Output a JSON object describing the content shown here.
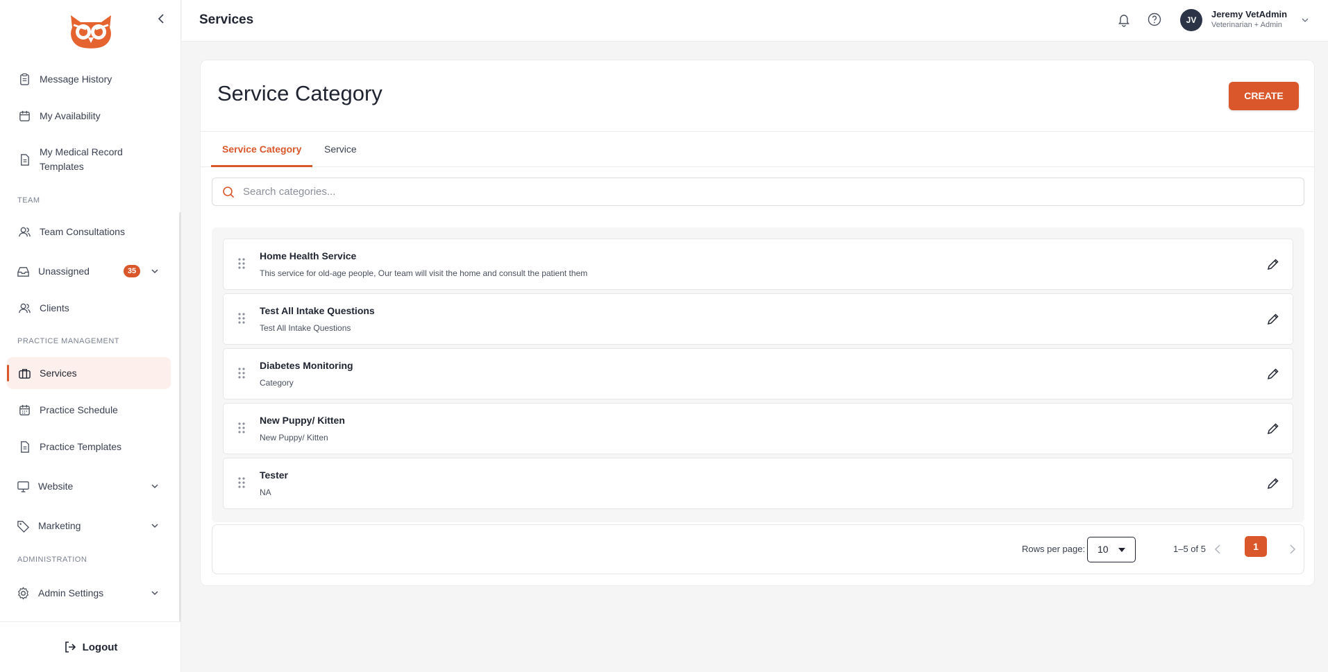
{
  "colors": {
    "accent": "#d9572a",
    "active_bg": "#fdf0ec",
    "avatar_bg": "#2b3346"
  },
  "sidebar": {
    "logo_icon": "owl-logo-icon",
    "items_top": [
      {
        "label": "Message History",
        "icon": "clipboard-icon"
      },
      {
        "label": "My Availability",
        "icon": "calendar-icon"
      },
      {
        "label": "My Medical Record Templates",
        "icon": "document-icon"
      }
    ],
    "section_team": "TEAM",
    "team_items": [
      {
        "label": "Team Consultations",
        "icon": "users-icon"
      },
      {
        "label": "Unassigned",
        "icon": "inbox-icon",
        "badge": "35"
      },
      {
        "label": "Clients",
        "icon": "people-icon"
      }
    ],
    "section_practice": "PRACTICE MANAGEMENT",
    "practice_items": [
      {
        "label": "Services",
        "icon": "briefcase-icon",
        "active": true
      },
      {
        "label": "Practice Schedule",
        "icon": "calendar-grid-icon"
      },
      {
        "label": "Practice Templates",
        "icon": "document-icon"
      },
      {
        "label": "Website",
        "icon": "monitor-icon"
      },
      {
        "label": "Marketing",
        "icon": "tag-icon"
      }
    ],
    "section_admin": "ADMINISTRATION",
    "admin_items": [
      {
        "label": "Admin Settings",
        "icon": "gear-icon"
      }
    ],
    "logout_label": "Logout"
  },
  "header": {
    "title": "Services",
    "user": {
      "initials": "JV",
      "name": "Jeremy VetAdmin",
      "role": "Veterinarian + Admin"
    }
  },
  "main": {
    "title": "Service Category",
    "create_label": "CREATE",
    "tabs": [
      {
        "label": "Service Category",
        "active": true
      },
      {
        "label": "Service",
        "active": false
      }
    ],
    "search_placeholder": "Search categories...",
    "rows": [
      {
        "title": "Home Health Service",
        "desc": "This service for old-age people, Our team will visit the home and consult the patient them"
      },
      {
        "title": "Test All Intake Questions",
        "desc": "Test All Intake Questions"
      },
      {
        "title": "Diabetes Monitoring",
        "desc": "Category"
      },
      {
        "title": "New Puppy/ Kitten",
        "desc": "New Puppy/ Kitten"
      },
      {
        "title": "Tester",
        "desc": "NA"
      }
    ],
    "pagination": {
      "rows_per_page_label": "Rows per page:",
      "rows_per_page": "10",
      "range": "1–5 of 5",
      "current_page": "1"
    }
  }
}
